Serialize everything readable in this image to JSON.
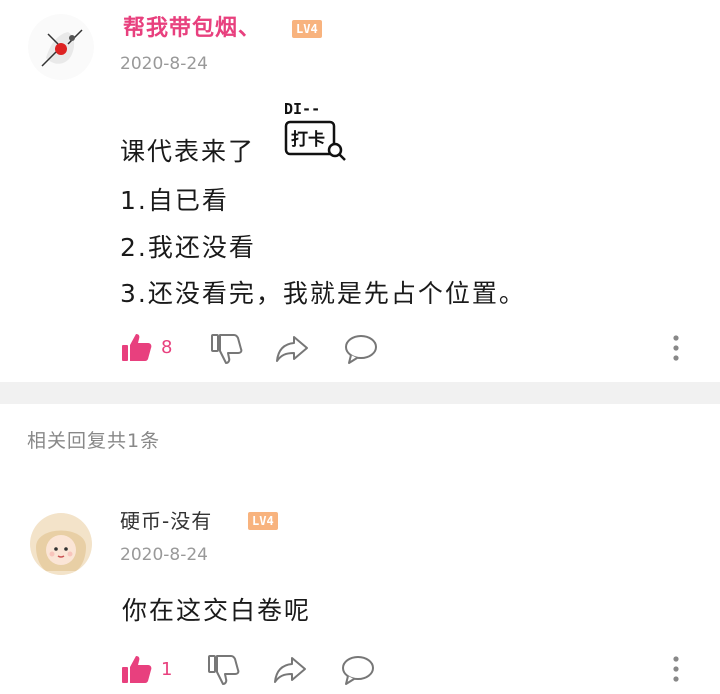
{
  "comment": {
    "username": "帮我带包烟、",
    "level": "LV4",
    "date": "2020-8-24",
    "lines": [
      "课代表来了",
      "1.自已看",
      "2.我还没看",
      "3.还没看完，我就是先占个位置。"
    ],
    "sticker": {
      "top_text": "DI--",
      "main_text": "打卡"
    },
    "like_count": "8",
    "icons": {
      "like": "thumbs-up-icon",
      "dislike": "thumbs-down-icon",
      "share": "share-icon",
      "reply": "comment-icon",
      "more": "more-vertical-icon"
    },
    "accent_color": "#e8407e"
  },
  "replies_header": "相关回复共1条",
  "reply": {
    "username": "硬币-没有",
    "level": "LV4",
    "date": "2020-8-24",
    "text": "你在这交白卷呢",
    "like_count": "1"
  }
}
